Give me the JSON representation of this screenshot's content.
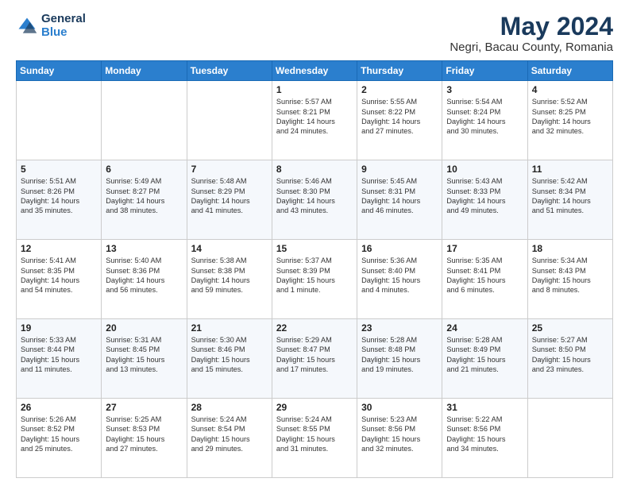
{
  "header": {
    "logo_line1": "General",
    "logo_line2": "Blue",
    "title": "May 2024",
    "subtitle": "Negri, Bacau County, Romania"
  },
  "days_of_week": [
    "Sunday",
    "Monday",
    "Tuesday",
    "Wednesday",
    "Thursday",
    "Friday",
    "Saturday"
  ],
  "weeks": [
    [
      {
        "day": "",
        "text": ""
      },
      {
        "day": "",
        "text": ""
      },
      {
        "day": "",
        "text": ""
      },
      {
        "day": "1",
        "text": "Sunrise: 5:57 AM\nSunset: 8:21 PM\nDaylight: 14 hours\nand 24 minutes."
      },
      {
        "day": "2",
        "text": "Sunrise: 5:55 AM\nSunset: 8:22 PM\nDaylight: 14 hours\nand 27 minutes."
      },
      {
        "day": "3",
        "text": "Sunrise: 5:54 AM\nSunset: 8:24 PM\nDaylight: 14 hours\nand 30 minutes."
      },
      {
        "day": "4",
        "text": "Sunrise: 5:52 AM\nSunset: 8:25 PM\nDaylight: 14 hours\nand 32 minutes."
      }
    ],
    [
      {
        "day": "5",
        "text": "Sunrise: 5:51 AM\nSunset: 8:26 PM\nDaylight: 14 hours\nand 35 minutes."
      },
      {
        "day": "6",
        "text": "Sunrise: 5:49 AM\nSunset: 8:27 PM\nDaylight: 14 hours\nand 38 minutes."
      },
      {
        "day": "7",
        "text": "Sunrise: 5:48 AM\nSunset: 8:29 PM\nDaylight: 14 hours\nand 41 minutes."
      },
      {
        "day": "8",
        "text": "Sunrise: 5:46 AM\nSunset: 8:30 PM\nDaylight: 14 hours\nand 43 minutes."
      },
      {
        "day": "9",
        "text": "Sunrise: 5:45 AM\nSunset: 8:31 PM\nDaylight: 14 hours\nand 46 minutes."
      },
      {
        "day": "10",
        "text": "Sunrise: 5:43 AM\nSunset: 8:33 PM\nDaylight: 14 hours\nand 49 minutes."
      },
      {
        "day": "11",
        "text": "Sunrise: 5:42 AM\nSunset: 8:34 PM\nDaylight: 14 hours\nand 51 minutes."
      }
    ],
    [
      {
        "day": "12",
        "text": "Sunrise: 5:41 AM\nSunset: 8:35 PM\nDaylight: 14 hours\nand 54 minutes."
      },
      {
        "day": "13",
        "text": "Sunrise: 5:40 AM\nSunset: 8:36 PM\nDaylight: 14 hours\nand 56 minutes."
      },
      {
        "day": "14",
        "text": "Sunrise: 5:38 AM\nSunset: 8:38 PM\nDaylight: 14 hours\nand 59 minutes."
      },
      {
        "day": "15",
        "text": "Sunrise: 5:37 AM\nSunset: 8:39 PM\nDaylight: 15 hours\nand 1 minute."
      },
      {
        "day": "16",
        "text": "Sunrise: 5:36 AM\nSunset: 8:40 PM\nDaylight: 15 hours\nand 4 minutes."
      },
      {
        "day": "17",
        "text": "Sunrise: 5:35 AM\nSunset: 8:41 PM\nDaylight: 15 hours\nand 6 minutes."
      },
      {
        "day": "18",
        "text": "Sunrise: 5:34 AM\nSunset: 8:43 PM\nDaylight: 15 hours\nand 8 minutes."
      }
    ],
    [
      {
        "day": "19",
        "text": "Sunrise: 5:33 AM\nSunset: 8:44 PM\nDaylight: 15 hours\nand 11 minutes."
      },
      {
        "day": "20",
        "text": "Sunrise: 5:31 AM\nSunset: 8:45 PM\nDaylight: 15 hours\nand 13 minutes."
      },
      {
        "day": "21",
        "text": "Sunrise: 5:30 AM\nSunset: 8:46 PM\nDaylight: 15 hours\nand 15 minutes."
      },
      {
        "day": "22",
        "text": "Sunrise: 5:29 AM\nSunset: 8:47 PM\nDaylight: 15 hours\nand 17 minutes."
      },
      {
        "day": "23",
        "text": "Sunrise: 5:28 AM\nSunset: 8:48 PM\nDaylight: 15 hours\nand 19 minutes."
      },
      {
        "day": "24",
        "text": "Sunrise: 5:28 AM\nSunset: 8:49 PM\nDaylight: 15 hours\nand 21 minutes."
      },
      {
        "day": "25",
        "text": "Sunrise: 5:27 AM\nSunset: 8:50 PM\nDaylight: 15 hours\nand 23 minutes."
      }
    ],
    [
      {
        "day": "26",
        "text": "Sunrise: 5:26 AM\nSunset: 8:52 PM\nDaylight: 15 hours\nand 25 minutes."
      },
      {
        "day": "27",
        "text": "Sunrise: 5:25 AM\nSunset: 8:53 PM\nDaylight: 15 hours\nand 27 minutes."
      },
      {
        "day": "28",
        "text": "Sunrise: 5:24 AM\nSunset: 8:54 PM\nDaylight: 15 hours\nand 29 minutes."
      },
      {
        "day": "29",
        "text": "Sunrise: 5:24 AM\nSunset: 8:55 PM\nDaylight: 15 hours\nand 31 minutes."
      },
      {
        "day": "30",
        "text": "Sunrise: 5:23 AM\nSunset: 8:56 PM\nDaylight: 15 hours\nand 32 minutes."
      },
      {
        "day": "31",
        "text": "Sunrise: 5:22 AM\nSunset: 8:56 PM\nDaylight: 15 hours\nand 34 minutes."
      },
      {
        "day": "",
        "text": ""
      }
    ]
  ]
}
